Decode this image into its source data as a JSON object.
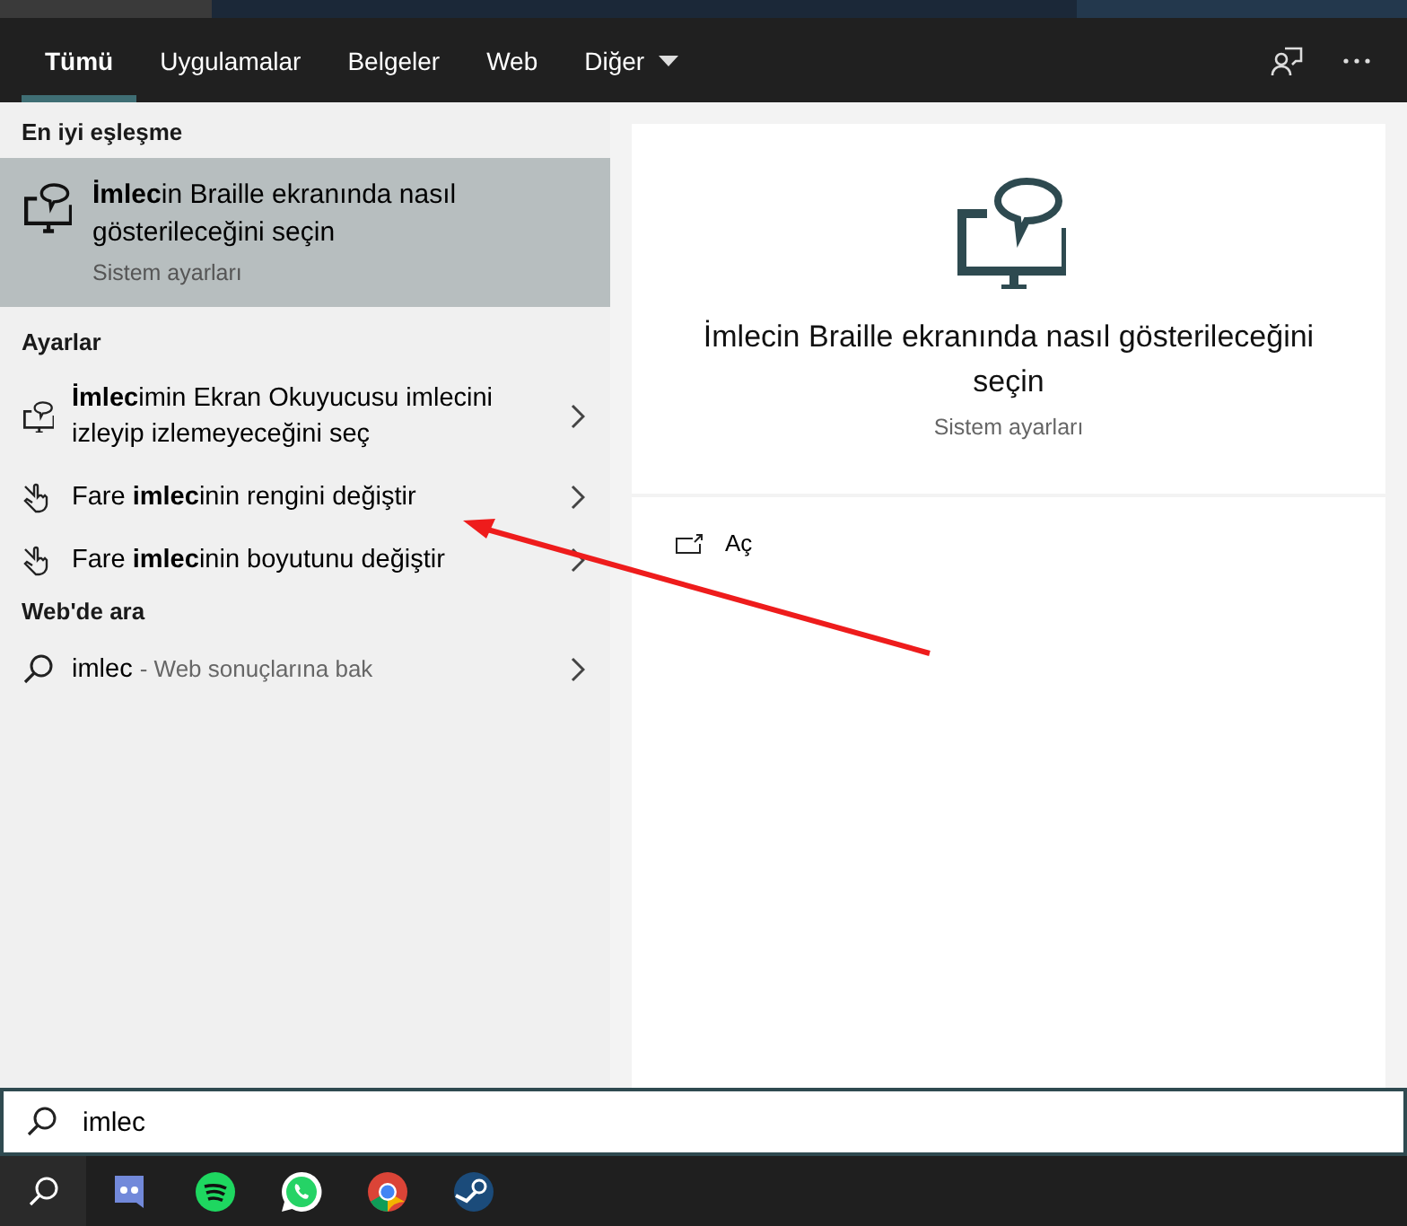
{
  "tabs": [
    {
      "label": "Tümü",
      "selected": true
    },
    {
      "label": "Uygulamalar",
      "selected": false
    },
    {
      "label": "Belgeler",
      "selected": false
    },
    {
      "label": "Web",
      "selected": false
    },
    {
      "label": "Diğer",
      "selected": false,
      "dropdown": true
    }
  ],
  "best_match": {
    "heading": "En iyi eşleşme",
    "title": "**İmlec**in Braille ekranında nasıl gösterileceğini seçin",
    "subtitle": "Sistem ayarları",
    "selected": true
  },
  "settings": {
    "heading": "Ayarlar",
    "items": [
      {
        "kind": "screen-reader",
        "label": "**İmlec**imin Ekran Okuyucusu imlecini izleyip izlemeyeceğini seç"
      },
      {
        "kind": "mouse",
        "label": "Fare **imlec**inin rengini değiştir"
      },
      {
        "kind": "mouse",
        "label": "Fare **imlec**inin boyutunu değiştir"
      }
    ]
  },
  "web": {
    "heading": "Web'de ara",
    "query": "imlec",
    "hint": "- Web sonuçlarına bak"
  },
  "preview": {
    "title": "İmlecin Braille ekranında nasıl gösterileceğini seçin",
    "subtitle": "Sistem ayarları",
    "actions": [
      {
        "label": "Aç"
      }
    ]
  },
  "search": {
    "value": "imlec"
  },
  "taskbar": {
    "apps": [
      {
        "kind": "discord"
      },
      {
        "kind": "spotify"
      },
      {
        "kind": "whatsapp"
      },
      {
        "kind": "chrome"
      },
      {
        "kind": "steam"
      }
    ]
  }
}
